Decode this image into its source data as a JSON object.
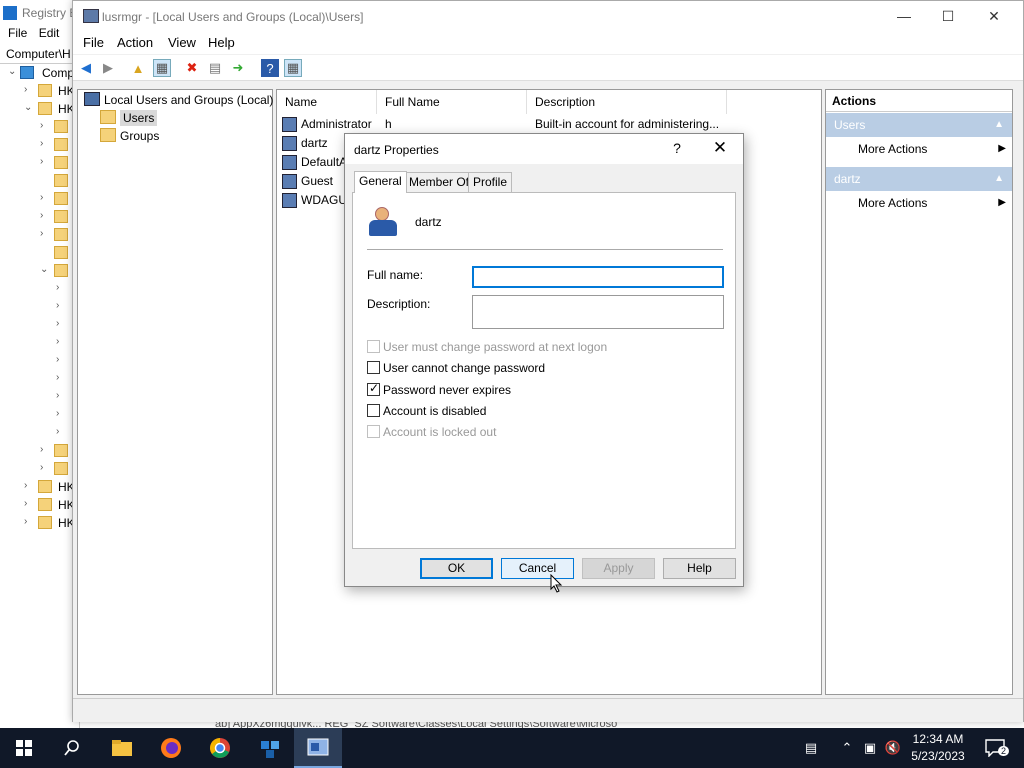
{
  "regedit": {
    "title": "Registry E",
    "menu": [
      "File",
      "Edit"
    ],
    "address": "Computer\\H",
    "tree": [
      {
        "label": "Comp",
        "kind": "computer"
      },
      {
        "label": "HK"
      },
      {
        "label": "HK"
      },
      {
        "label": ""
      },
      {
        "label": ""
      },
      {
        "label": ""
      },
      {
        "label": ""
      },
      {
        "label": ""
      },
      {
        "label": ""
      },
      {
        "label": ""
      },
      {
        "label": ""
      },
      {
        "label": ""
      },
      {
        "label": ""
      },
      {
        "label": ""
      },
      {
        "label": ""
      },
      {
        "label": ""
      },
      {
        "label": ""
      },
      {
        "label": ""
      },
      {
        "label": ""
      },
      {
        "label": ""
      },
      {
        "label": ""
      },
      {
        "label": ""
      },
      {
        "label": "HK"
      },
      {
        "label": "HK"
      },
      {
        "label": "HK"
      }
    ],
    "bottom_text": "ab] AppXz6mgquivk... REG_SZ          Software\\Classes\\Local Settings\\Software\\Microso"
  },
  "window": {
    "title": "lusrmgr - [Local Users and Groups (Local)\\Users]",
    "menu": [
      "File",
      "Action",
      "View",
      "Help"
    ]
  },
  "tree": {
    "root": "Local Users and Groups (Local)",
    "children": [
      "Users",
      "Groups"
    ],
    "selected": "Users"
  },
  "list": {
    "columns": [
      "Name",
      "Full Name",
      "Description"
    ],
    "rows": [
      {
        "name": "Administrator",
        "full_name": "h",
        "description": "Built-in account for administering..."
      },
      {
        "name": "dartz",
        "full_name": "",
        "description": ""
      },
      {
        "name": "DefaultA",
        "full_name": "",
        "description": ""
      },
      {
        "name": "Guest",
        "full_name": "",
        "description": ""
      },
      {
        "name": "WDAGUt",
        "full_name": "",
        "description": ""
      }
    ]
  },
  "actions": {
    "header": "Actions",
    "sections": [
      {
        "title": "Users",
        "items": [
          "More Actions"
        ]
      },
      {
        "title": "dartz",
        "items": [
          "More Actions"
        ]
      }
    ]
  },
  "dialog": {
    "title": "dartz Properties",
    "help_glyph": "?",
    "close_glyph": "✕",
    "tabs": [
      "General",
      "Member Of",
      "Profile"
    ],
    "active_tab": "General",
    "username": "dartz",
    "full_name_label": "Full name:",
    "full_name_value": "",
    "description_label": "Description:",
    "description_value": "",
    "checkboxes": [
      {
        "label": "User must change password at next logon",
        "checked": false,
        "disabled": true
      },
      {
        "label": "User cannot change password",
        "checked": false,
        "disabled": false
      },
      {
        "label": "Password never expires",
        "checked": true,
        "disabled": false
      },
      {
        "label": "Account is disabled",
        "checked": false,
        "disabled": false
      },
      {
        "label": "Account is locked out",
        "checked": false,
        "disabled": true
      }
    ],
    "buttons": {
      "ok": "OK",
      "cancel": "Cancel",
      "apply": "Apply",
      "help": "Help"
    }
  },
  "taskbar": {
    "time": "12:34 AM",
    "date": "5/23/2023",
    "notification_count": "2"
  },
  "colors": {
    "accent": "#0078d7",
    "taskbar": "#101828",
    "actions_section": "#b9cde4"
  }
}
